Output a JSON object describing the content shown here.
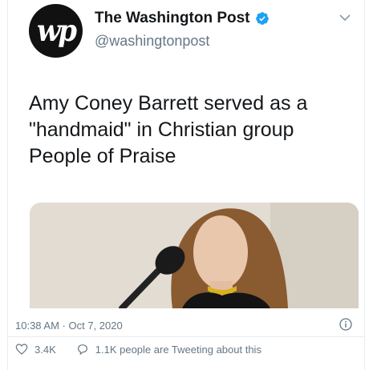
{
  "tweet": {
    "display_name": "The Washington Post",
    "handle": "@washingtonpost",
    "avatar_text": "wp",
    "text_lines": [
      "Amy Coney Barrett served as a",
      "\"handmaid\" in Christian group",
      "People of Praise"
    ],
    "timestamp": "10:38 AM · Oct 7, 2020",
    "likes": "3.4K",
    "tweeting_about": "1.1K people are Tweeting about this"
  },
  "colors": {
    "verified": "#1da1f2",
    "secondary_text": "#657786",
    "primary_text": "#14171a",
    "avatar_bg": "#111111"
  },
  "icons": {
    "verified": "verified-badge-icon",
    "caret": "chevron-down-icon",
    "info": "info-icon",
    "like": "heart-icon",
    "reply": "speech-bubble-icon"
  }
}
